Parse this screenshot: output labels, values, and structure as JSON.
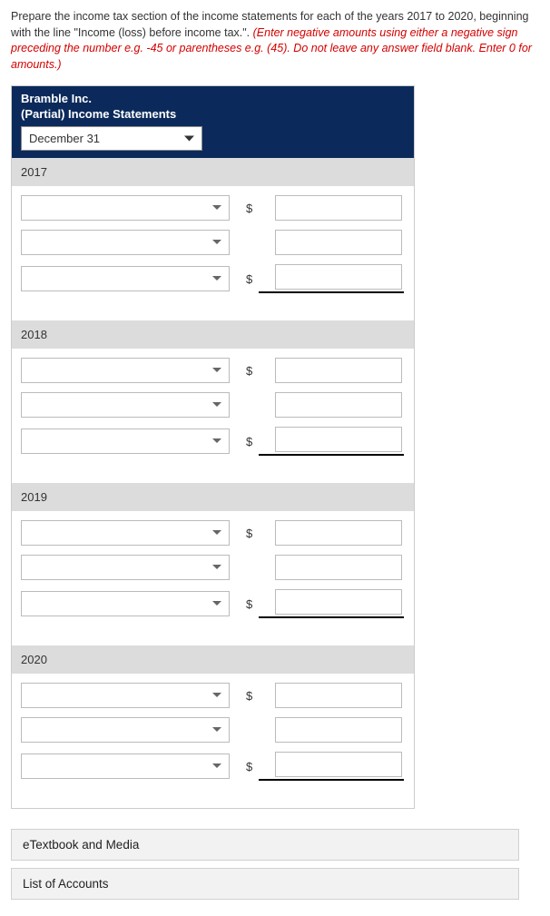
{
  "instructions": {
    "text_black_1": "Prepare the income tax section of the income statements for each of the years 2017 to 2020, beginning with the line \"Income (loss) before income tax.\". ",
    "text_red": "(Enter negative amounts using either a negative sign preceding the number e.g. -45 or parentheses e.g. (45). Do not leave any answer field blank. Enter 0 for amounts.)"
  },
  "header": {
    "company": "Bramble Inc.",
    "subtitle": "(Partial) Income Statements",
    "date_label": "December 31"
  },
  "years": [
    "2017",
    "2018",
    "2019",
    "2020"
  ],
  "currency_symbol": "$",
  "footer": {
    "etextbook": "eTextbook and Media",
    "accounts": "List of Accounts"
  }
}
